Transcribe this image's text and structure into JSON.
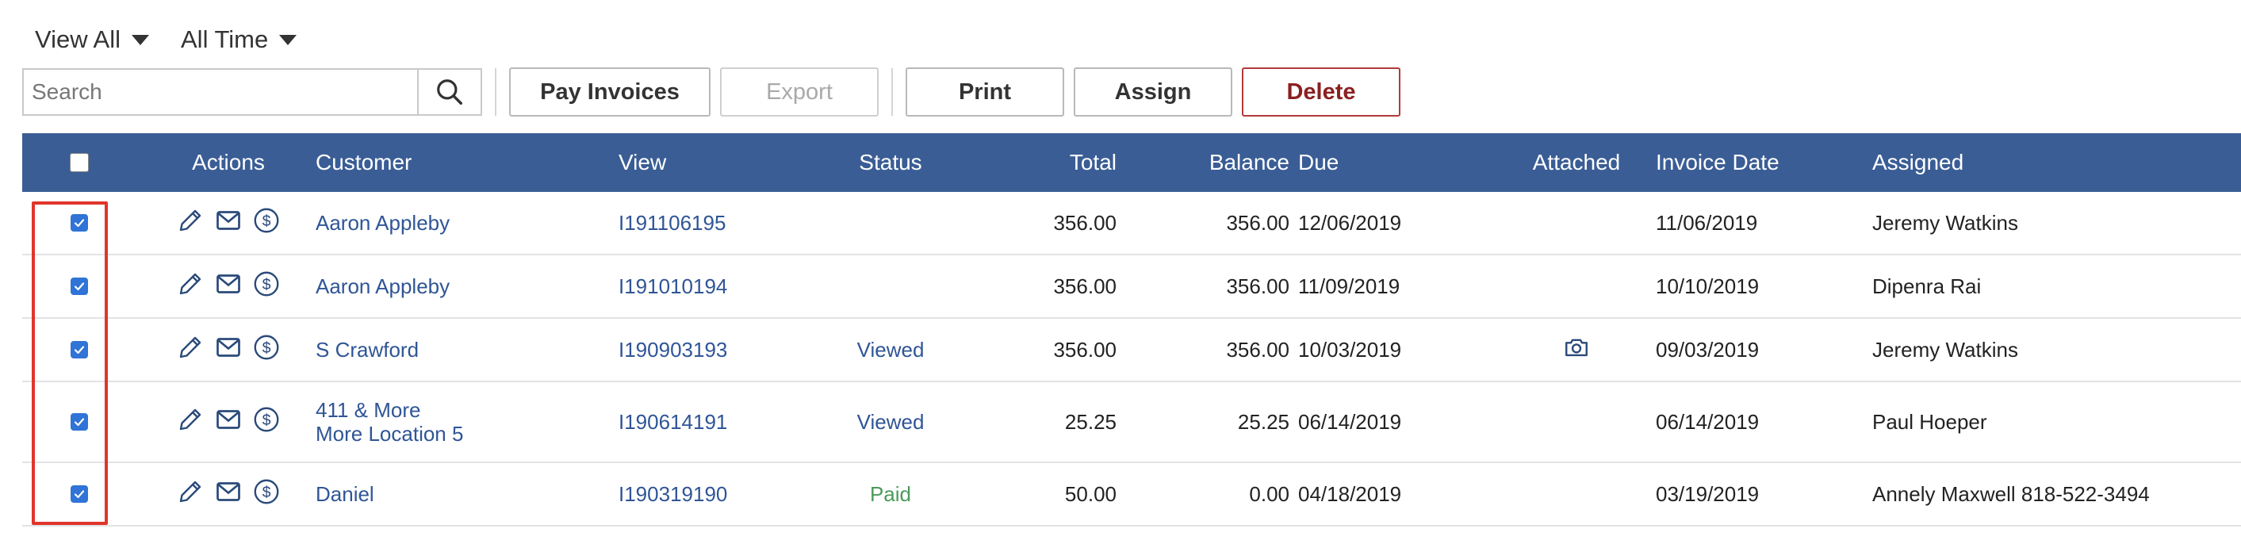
{
  "filters": {
    "view": "View All",
    "time": "All Time"
  },
  "toolbar": {
    "search_placeholder": "Search",
    "pay_label": "Pay Invoices",
    "export_label": "Export",
    "print_label": "Print",
    "assign_label": "Assign",
    "delete_label": "Delete"
  },
  "table": {
    "headers": {
      "actions": "Actions",
      "customer": "Customer",
      "view": "View",
      "status": "Status",
      "total": "Total",
      "balance": "Balance",
      "due": "Due",
      "attached": "Attached",
      "invoice_date": "Invoice Date",
      "assigned": "Assigned"
    },
    "rows": [
      {
        "customer": "Aaron Appleby",
        "customer2": "",
        "invoice": "I191106195",
        "status": "",
        "total": "356.00",
        "balance": "356.00",
        "due": "12/06/2019",
        "attached": false,
        "invoice_date": "11/06/2019",
        "assigned": "Jeremy Watkins"
      },
      {
        "customer": "Aaron Appleby",
        "customer2": "",
        "invoice": "I191010194",
        "status": "",
        "total": "356.00",
        "balance": "356.00",
        "due": "11/09/2019",
        "attached": false,
        "invoice_date": "10/10/2019",
        "assigned": "Dipenra Rai"
      },
      {
        "customer": "S Crawford",
        "customer2": "",
        "invoice": "I190903193",
        "status": "Viewed",
        "total": "356.00",
        "balance": "356.00",
        "due": "10/03/2019",
        "attached": true,
        "invoice_date": "09/03/2019",
        "assigned": "Jeremy Watkins"
      },
      {
        "customer": "411 & More",
        "customer2": "More Location 5",
        "invoice": "I190614191",
        "status": "Viewed",
        "total": "25.25",
        "balance": "25.25",
        "due": "06/14/2019",
        "attached": false,
        "invoice_date": "06/14/2019",
        "assigned": "Paul Hoeper"
      },
      {
        "customer": "Daniel",
        "customer2": "",
        "invoice": "I190319190",
        "status": "Paid",
        "total": "50.00",
        "balance": "0.00",
        "due": "04/18/2019",
        "attached": false,
        "invoice_date": "03/19/2019",
        "assigned": "Annely Maxwell 818-522-3494"
      }
    ]
  },
  "colors": {
    "header_bg": "#3a5d95",
    "link": "#2f5596",
    "paid": "#4a9b5a",
    "highlight": "#e0352b",
    "delete": "#8b2020"
  },
  "icons": [
    "search-icon",
    "chevron-down-icon",
    "edit-icon",
    "email-icon",
    "dollar-icon",
    "camera-icon",
    "checkmark-icon"
  ]
}
